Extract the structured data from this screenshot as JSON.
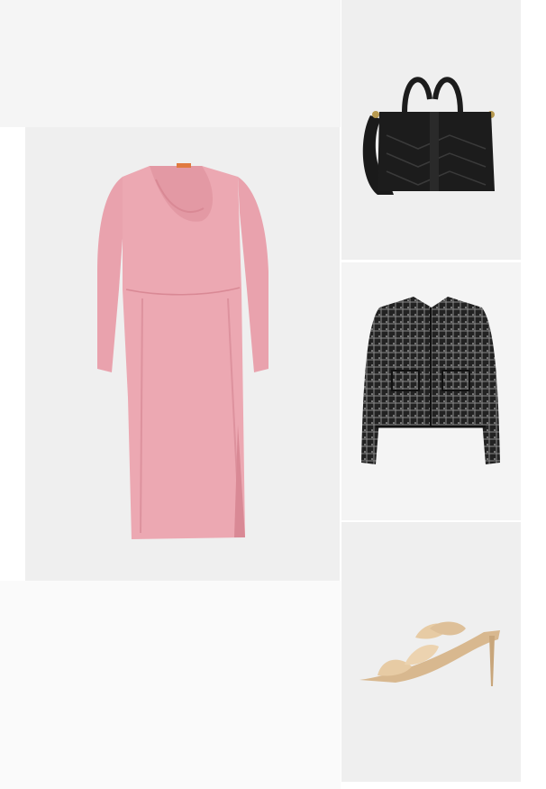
{
  "colors": {
    "page_background": "#ffffff",
    "tile_background": "#efefef",
    "dress": "#eca8b2",
    "dress_shadow": "#d98995",
    "bag": "#1c1c1c",
    "jacket": "#222222",
    "sandal": "#e7cba4"
  },
  "products": [
    {
      "id": "dress",
      "icon": "pink-cowl-neck-dress"
    },
    {
      "id": "bag",
      "icon": "black-quilted-tote-bag"
    },
    {
      "id": "jacket",
      "icon": "black-tweed-jacket"
    },
    {
      "id": "sandal",
      "icon": "beige-knotted-mule-sandal"
    }
  ]
}
